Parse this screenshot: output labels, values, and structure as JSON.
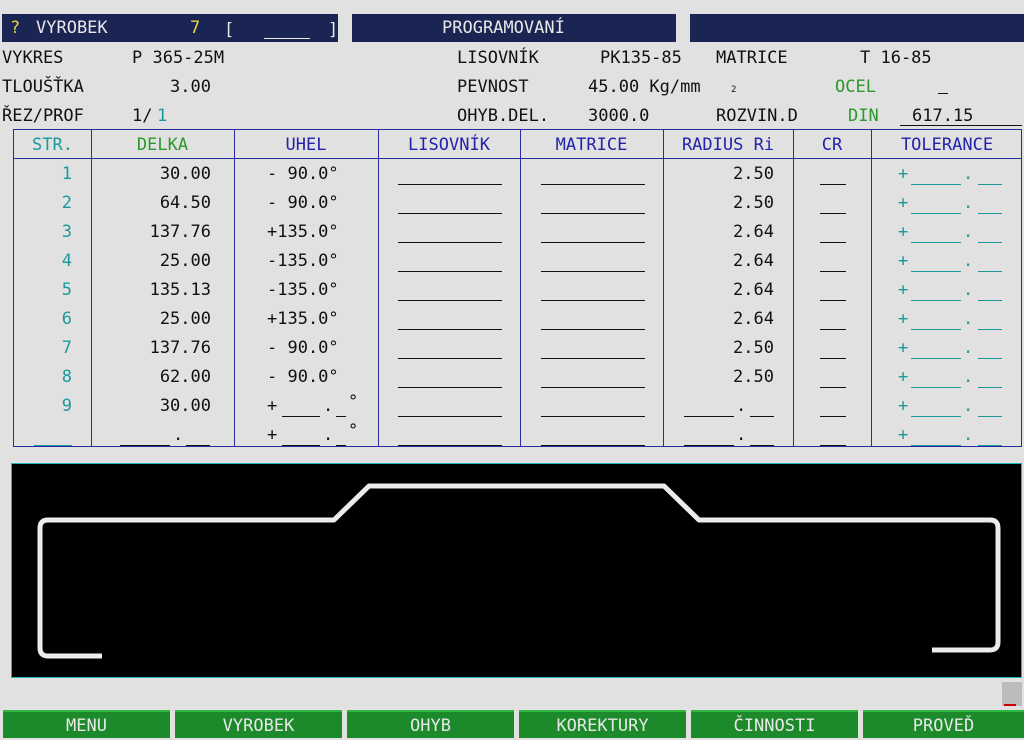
{
  "header": {
    "prompt": "?",
    "product_label": "VYROBEK",
    "product_value": "7",
    "bracket_open": "[",
    "bracket_close": "]",
    "mode_title": "PROGRAMOVANÍ"
  },
  "info": {
    "drawing_label": "VYKRES",
    "drawing_value": "P 365-25M",
    "thickness_label": "TLOUŠŤKA",
    "thickness_value": "3.00",
    "cut_label": "ŘEZ/PROF",
    "cut_value_a": "1/",
    "cut_value_b": "1",
    "punch_label": "LISOVNÍK",
    "punch_value": "PK135-85",
    "die_label": "MATRICE",
    "die_value": "T 16-85",
    "strength_label": "PEVNOST",
    "strength_value": "45.00 Kg/mm",
    "strength_exp": "2",
    "material_value": "OCEL",
    "bend_len_label": "OHYB.DEL.",
    "bend_len_value": "3000.0",
    "unroll_label": "ROZVIN.D",
    "unroll_std": "DIN",
    "unroll_value": "617.15"
  },
  "table": {
    "headers": [
      "STR.",
      "DELKA",
      "UHEL",
      "LISOVNÍK",
      "MATRICE",
      "RADIUS Ri",
      "CR",
      "TOLERANCE"
    ],
    "rows": [
      {
        "str": "1",
        "delka": "30.00",
        "uhel": "- 90.0°",
        "radius": "2.50"
      },
      {
        "str": "2",
        "delka": "64.50",
        "uhel": "- 90.0°",
        "radius": "2.50"
      },
      {
        "str": "3",
        "delka": "137.76",
        "uhel": "+135.0°",
        "radius": "2.64"
      },
      {
        "str": "4",
        "delka": "25.00",
        "uhel": "-135.0°",
        "radius": "2.64"
      },
      {
        "str": "5",
        "delka": "135.13",
        "uhel": "-135.0°",
        "radius": "2.64"
      },
      {
        "str": "6",
        "delka": "25.00",
        "uhel": "+135.0°",
        "radius": "2.64"
      },
      {
        "str": "7",
        "delka": "137.76",
        "uhel": "- 90.0°",
        "radius": "2.50"
      },
      {
        "str": "8",
        "delka": "62.00",
        "uhel": "- 90.0°",
        "radius": "2.50"
      },
      {
        "str": "9",
        "delka": "30.00",
        "uhel": "+",
        "radius": ""
      },
      {
        "str": "",
        "delka": "",
        "uhel": "+",
        "radius": ""
      }
    ],
    "tolerance_sign": "+",
    "decimal_point": ".",
    "degree": "°"
  },
  "softkeys": [
    "MENU",
    "VYROBEK",
    "OHYB",
    "KOREKTURY",
    "ČINNOSTI",
    "PROVEĎ"
  ],
  "colors": {
    "topbar": "#1b2553",
    "grid": "#2a2aa0",
    "teal": "#1a9a9a",
    "green": "#2a9a2a",
    "softkey": "#1c8a2a"
  }
}
